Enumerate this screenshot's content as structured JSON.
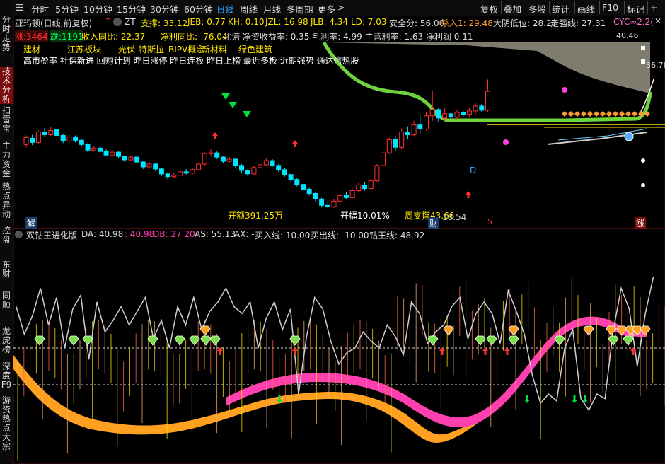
{
  "sidebar": {
    "items": [
      {
        "label": "分时走势",
        "active": false
      },
      {
        "label": "技术分析",
        "active": true
      },
      {
        "label": "扫雷宝",
        "active": false
      },
      {
        "label": "主力资金",
        "active": false
      },
      {
        "label": "热点异动",
        "active": false
      },
      {
        "label": "控盘",
        "active": false
      },
      {
        "label": "东财",
        "active": false
      },
      {
        "label": "同顺",
        "active": false
      },
      {
        "label": "龙虎榜",
        "active": false
      },
      {
        "label": "深度F9",
        "active": false
      },
      {
        "label": "游资热点",
        "active": false
      },
      {
        "label": "大宗",
        "active": false
      }
    ]
  },
  "toolbar": {
    "periods": [
      "分时",
      "5分钟",
      "10分钟",
      "15分钟",
      "30分钟",
      "60分钟",
      "日线",
      "周线",
      "月线",
      "多周期",
      "更多"
    ],
    "active_period": "日线",
    "more_arrow": ">",
    "right_buttons": [
      "复权",
      "叠加",
      "多股",
      "统计",
      "画线",
      "F10",
      "标记",
      "+"
    ]
  },
  "info_row": {
    "stock": "亚玛顿(日线,前复权)",
    "zt": "ZT",
    "support": "支撑: 33.12",
    "jeb": "JEB: 0.77",
    "kh": "KH: 0.10",
    "jzl": "JZL: 16.98",
    "jlb": "JLB: 4.34",
    "ld": "LD: 7.03",
    "safety": "安全分: 56.00",
    "sell": "杀入1: 29.48",
    "yin": "大阴低位: 28.27",
    "trend": "走强线: 27.31",
    "cyc": "CYC∞2.2("
  },
  "info_row2": {
    "zhang": "涨:3464",
    "die": "跌:1191",
    "revenue": "收入同比: 22.37",
    "profit": "净利同比: -76.04",
    "industry": "北诺  净资收益率: 0.35  毛利率: 4.99  主营利率: 1.63  净利润 0.11"
  },
  "concepts": {
    "row1": [
      "建材",
      "江苏板块",
      "光伏",
      "特斯拉",
      "BIPV概念",
      "新材料",
      "绿色建筑"
    ],
    "row2": "高市盈率 社保新进 回购计划 昨日涨停 昨日连板 昨日上榜 最近多板 近期强势 通达信热股"
  },
  "annotations": {
    "kaie": "开额391.25万",
    "kaifu": "开幅10.01%",
    "zhoucheng": "周支撑43.66",
    "low_price": "18.54",
    "high_price": "36.78",
    "right_top_price": "40.46",
    "d_marker": "D",
    "jie": "解",
    "cai": "财",
    "zhang_tag": "涨",
    "s_tag": "S"
  },
  "lower_panel": {
    "title": "双钻王进化版",
    "da": "DA: 40.98",
    "da2": ": 40.98",
    "db": "DB: 27.20",
    "as": "AS: 55.13",
    "ax": "AX: -",
    "buy": "买入线: 10.00",
    "sell": "买出线: -10.00",
    "king": "钻王线: 48.92"
  },
  "colors": {
    "up": "#ff3030",
    "down": "#00e5ff",
    "trend_green": "#6fd43c",
    "cloud": "#8d8a7a",
    "pink": "#ff3fb0",
    "orange": "#ffa020",
    "white_line": "#d0d0d0",
    "accent_blue": "#2fa8ff"
  },
  "chart_data": {
    "type": "candlestick",
    "price_range": [
      16.5,
      42
    ],
    "candles": [
      [
        27.6,
        28.6,
        27.2,
        28.9
      ],
      [
        28.5,
        27.9,
        27.5,
        29.0
      ],
      [
        27.9,
        29.4,
        27.7,
        29.6
      ],
      [
        29.3,
        29.0,
        28.7,
        30.0
      ],
      [
        29.0,
        29.6,
        28.8,
        30.1
      ],
      [
        29.7,
        28.9,
        28.5,
        29.9
      ],
      [
        28.9,
        28.1,
        27.8,
        29.1
      ],
      [
        28.1,
        28.7,
        27.9,
        29.0
      ],
      [
        28.7,
        28.2,
        27.9,
        28.9
      ],
      [
        28.2,
        27.6,
        27.3,
        28.4
      ],
      [
        27.6,
        26.8,
        26.5,
        27.8
      ],
      [
        26.8,
        27.1,
        26.6,
        27.4
      ],
      [
        27.1,
        26.6,
        26.3,
        27.3
      ],
      [
        26.6,
        26.1,
        25.9,
        26.9
      ],
      [
        26.1,
        26.5,
        25.9,
        26.8
      ],
      [
        26.5,
        25.9,
        25.6,
        26.7
      ],
      [
        25.9,
        25.4,
        25.1,
        26.1
      ],
      [
        25.4,
        25.8,
        25.2,
        26.0
      ],
      [
        25.8,
        25.1,
        24.8,
        26.0
      ],
      [
        25.1,
        24.4,
        24.1,
        25.3
      ],
      [
        24.4,
        24.8,
        24.2,
        25.1
      ],
      [
        24.8,
        24.1,
        23.8,
        25.0
      ],
      [
        24.1,
        23.4,
        23.1,
        24.3
      ],
      [
        23.4,
        23.0,
        22.6,
        23.6
      ],
      [
        23.0,
        23.2,
        22.8,
        23.5
      ],
      [
        23.2,
        23.7,
        23.0,
        23.9
      ],
      [
        23.7,
        23.5,
        23.3,
        24.1
      ],
      [
        23.5,
        24.0,
        23.3,
        24.3
      ],
      [
        24.0,
        24.8,
        23.9,
        25.0
      ],
      [
        24.8,
        26.3,
        24.6,
        26.5
      ],
      [
        26.3,
        26.4,
        25.9,
        27.0
      ],
      [
        26.4,
        25.8,
        25.5,
        26.6
      ],
      [
        25.8,
        25.2,
        24.9,
        26.0
      ],
      [
        25.2,
        25.5,
        24.9,
        25.8
      ],
      [
        25.5,
        24.6,
        24.3,
        25.7
      ],
      [
        24.6,
        23.9,
        23.6,
        24.8
      ],
      [
        23.9,
        23.4,
        23.1,
        24.1
      ],
      [
        23.4,
        24.3,
        23.2,
        24.5
      ],
      [
        24.3,
        24.7,
        24.0,
        25.0
      ],
      [
        24.7,
        25.3,
        24.6,
        25.6
      ],
      [
        25.3,
        24.6,
        24.4,
        25.5
      ],
      [
        24.6,
        24.0,
        23.7,
        24.8
      ],
      [
        24.0,
        23.3,
        23.0,
        24.2
      ],
      [
        23.3,
        22.6,
        22.3,
        23.5
      ],
      [
        22.6,
        21.9,
        21.6,
        22.8
      ],
      [
        21.9,
        21.2,
        20.9,
        22.1
      ],
      [
        21.2,
        20.6,
        20.3,
        21.4
      ],
      [
        20.6,
        19.8,
        19.5,
        20.8
      ],
      [
        19.8,
        18.9,
        18.6,
        20.0
      ],
      [
        18.9,
        18.7,
        18.5,
        19.5
      ],
      [
        18.7,
        19.5,
        18.5,
        19.8
      ],
      [
        19.5,
        20.3,
        19.3,
        20.6
      ],
      [
        20.3,
        20.0,
        19.8,
        20.8
      ],
      [
        20.0,
        21.0,
        19.9,
        21.3
      ],
      [
        21.0,
        21.8,
        20.8,
        22.1
      ],
      [
        21.8,
        21.3,
        21.0,
        22.2
      ],
      [
        21.3,
        22.4,
        21.2,
        22.7
      ],
      [
        22.4,
        24.6,
        22.2,
        24.8
      ],
      [
        24.6,
        26.4,
        24.4,
        26.8
      ],
      [
        26.4,
        28.3,
        26.2,
        28.6
      ],
      [
        28.3,
        27.2,
        26.7,
        28.8
      ],
      [
        27.2,
        29.4,
        27.0,
        29.9
      ],
      [
        29.4,
        29.0,
        28.4,
        30.2
      ],
      [
        29.0,
        30.4,
        28.8,
        31.0
      ],
      [
        30.4,
        29.8,
        29.2,
        31.8
      ],
      [
        29.8,
        31.7,
        29.6,
        32.2
      ],
      [
        31.7,
        32.6,
        31.0,
        35.3
      ],
      [
        32.6,
        31.4,
        30.8,
        32.9
      ],
      [
        31.4,
        32.0,
        31.0,
        32.8
      ],
      [
        32.0,
        31.5,
        31.0,
        32.3
      ],
      [
        31.5,
        32.2,
        31.2,
        32.6
      ],
      [
        32.2,
        31.9,
        31.6,
        32.5
      ],
      [
        31.9,
        32.4,
        31.6,
        32.8
      ],
      [
        32.4,
        33.1,
        32.0,
        33.5
      ],
      [
        33.1,
        32.5,
        32.2,
        33.4
      ],
      [
        32.5,
        35.2,
        32.3,
        36.9
      ]
    ],
    "lower": {
      "white_line": [
        58,
        46,
        54,
        66,
        50,
        62,
        40,
        57,
        63,
        35,
        60,
        47,
        52,
        58,
        50,
        56,
        62,
        44,
        52,
        40,
        58,
        50,
        62,
        48,
        56,
        60,
        66,
        58,
        55,
        60,
        40,
        53,
        60,
        48,
        57,
        20,
        45,
        62,
        57,
        43,
        33,
        38,
        40,
        47,
        43,
        40,
        50,
        45,
        37,
        60,
        55,
        42,
        47,
        50,
        58,
        62,
        44,
        55,
        60,
        55,
        42,
        65,
        56,
        46,
        28,
        16,
        20,
        17,
        40,
        48,
        18,
        13,
        20,
        18,
        47,
        66,
        57,
        32,
        55,
        71
      ]
    }
  }
}
